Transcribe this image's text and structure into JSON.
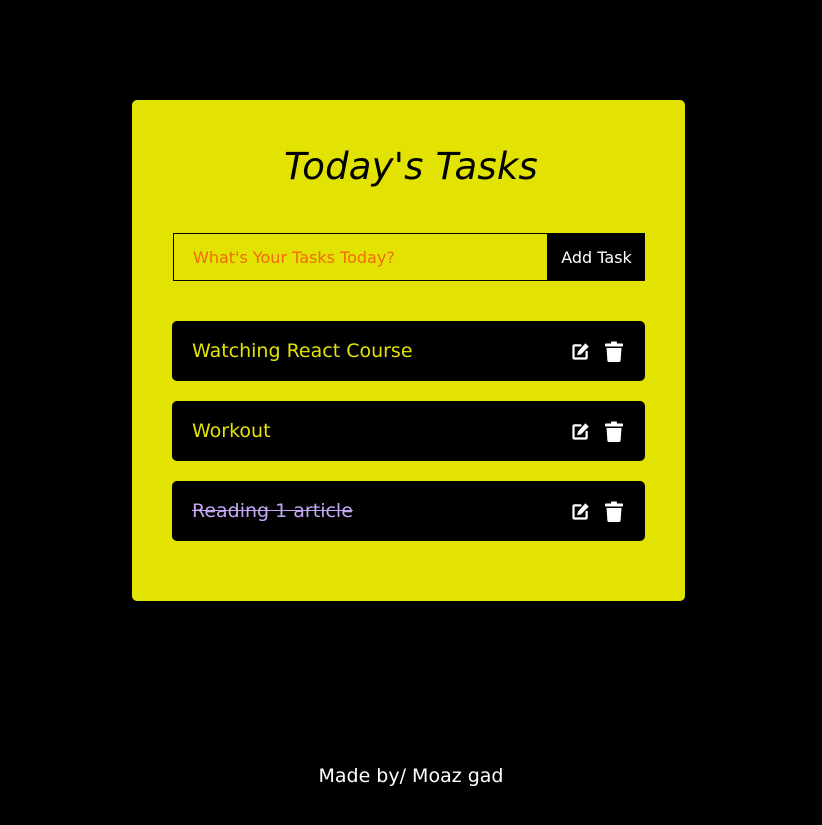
{
  "header": {
    "title": "Today's Tasks"
  },
  "form": {
    "placeholder": "What's Your Tasks Today?",
    "value": "",
    "add_label": "Add Task"
  },
  "tasks": [
    {
      "text": "Watching React Course",
      "completed": false
    },
    {
      "text": "Workout",
      "completed": false
    },
    {
      "text": "Reading 1 article",
      "completed": true
    }
  ],
  "footer": {
    "credit": "Made by/ Moaz gad"
  },
  "colors": {
    "background": "#000000",
    "card": "#e2e303",
    "task_text": "#e2e303",
    "completed_text": "#c3a7f4",
    "placeholder": "#f26a0a",
    "icon": "#ffffff"
  },
  "icons": {
    "edit": "edit-icon",
    "delete": "trash-icon"
  }
}
